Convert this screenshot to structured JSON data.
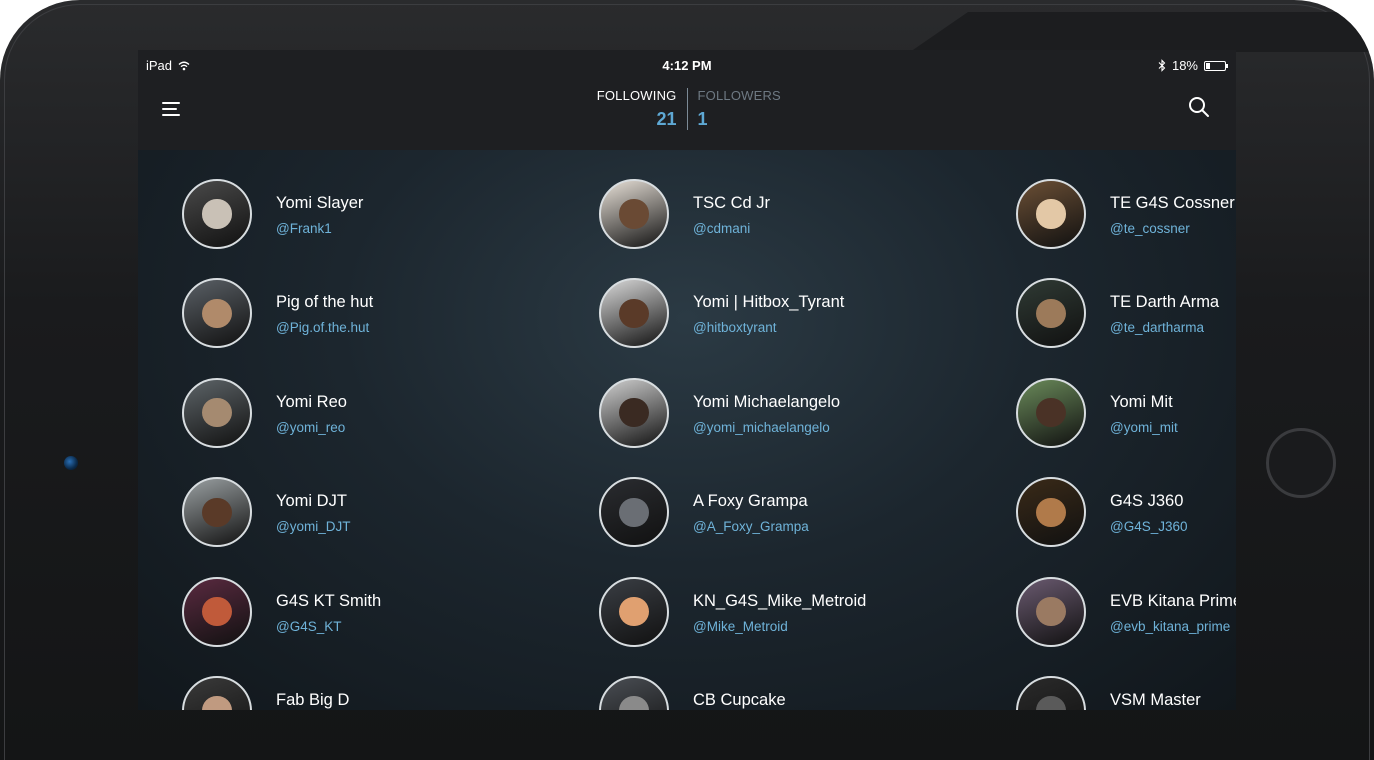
{
  "status_bar": {
    "device": "iPad",
    "time": "4:12 PM",
    "battery": "18%"
  },
  "nav": {
    "following_label": "FOLLOWING",
    "following_count": "21",
    "followers_label": "FOLLOWERS",
    "followers_count": "1"
  },
  "users": [
    {
      "name": "Yomi Slayer",
      "handle": "@Frank1"
    },
    {
      "name": "TSC Cd Jr",
      "handle": "@cdmani"
    },
    {
      "name": "TE G4S Cossner",
      "handle": "@te_cossner"
    },
    {
      "name": "Pig of the hut",
      "handle": "@Pig.of.the.hut"
    },
    {
      "name": "Yomi | Hitbox_Tyrant",
      "handle": "@hitboxtyrant"
    },
    {
      "name": "TE Darth Arma",
      "handle": "@te_dartharma"
    },
    {
      "name": "Yomi Reo",
      "handle": "@yomi_reo"
    },
    {
      "name": "Yomi Michaelangelo",
      "handle": "@yomi_michaelangelo"
    },
    {
      "name": "Yomi Mit",
      "handle": "@yomi_mit"
    },
    {
      "name": "Yomi DJT",
      "handle": "@yomi_DJT"
    },
    {
      "name": "A Foxy Grampa",
      "handle": "@A_Foxy_Grampa"
    },
    {
      "name": "G4S J360",
      "handle": "@G4S_J360"
    },
    {
      "name": "G4S KT Smith",
      "handle": "@G4S_KT"
    },
    {
      "name": "KN_G4S_Mike_Metroid",
      "handle": "@Mike_Metroid"
    },
    {
      "name": "EVB Kitana Prime",
      "handle": "@evb_kitana_prime"
    },
    {
      "name": "Fab Big D",
      "handle": ""
    },
    {
      "name": "CB Cupcake",
      "handle": ""
    },
    {
      "name": "VSM Master",
      "handle": ""
    }
  ]
}
